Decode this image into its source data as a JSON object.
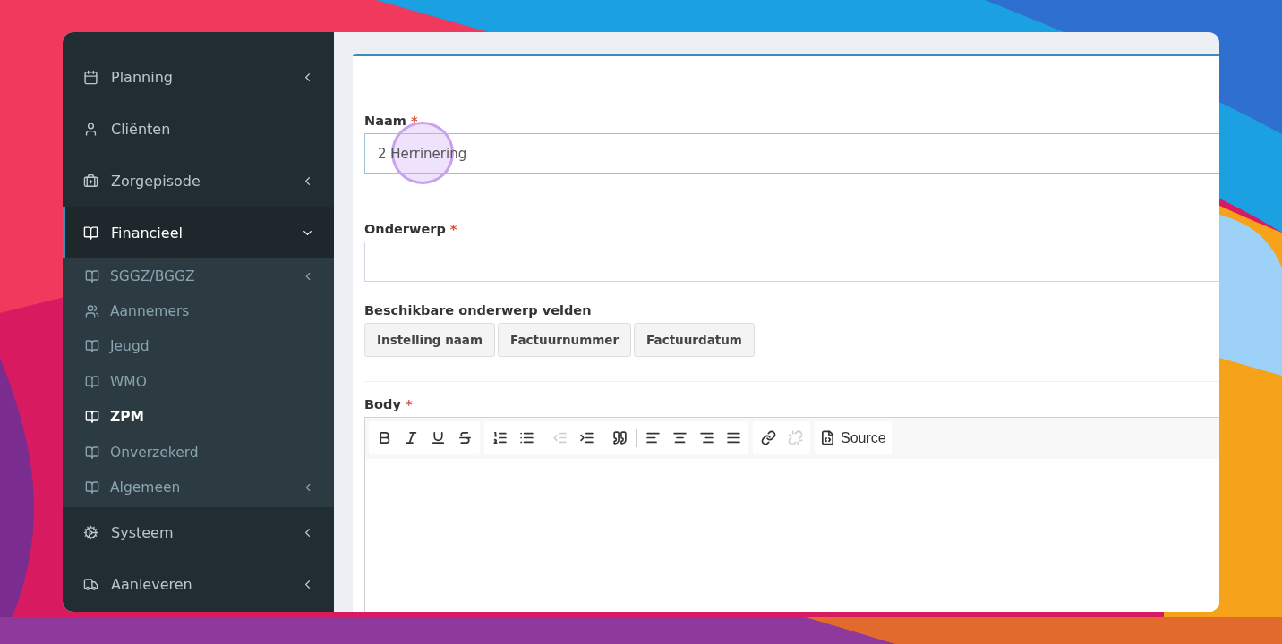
{
  "sidebar": {
    "items": [
      {
        "label": "Planning",
        "kind": "calendar",
        "selected": false,
        "expanded": false,
        "has_submenu": true
      },
      {
        "label": "Cliënten",
        "kind": "user",
        "selected": false,
        "has_submenu": false
      },
      {
        "label": "Zorgepisode",
        "kind": "medkit",
        "selected": false,
        "expanded": false,
        "has_submenu": true
      },
      {
        "label": "Financieel",
        "kind": "book",
        "selected": true,
        "expanded": true,
        "has_submenu": true,
        "children": [
          {
            "label": "SGGZ/BGGZ",
            "kind": "book",
            "selected": false,
            "has_submenu": true
          },
          {
            "label": "Aannemers",
            "kind": "users",
            "selected": false,
            "has_submenu": false
          },
          {
            "label": "Jeugd",
            "kind": "book",
            "selected": false,
            "has_submenu": false
          },
          {
            "label": "WMO",
            "kind": "book",
            "selected": false,
            "has_submenu": false
          },
          {
            "label": "ZPM",
            "kind": "book",
            "selected": true,
            "has_submenu": false
          },
          {
            "label": "Onverzekerd",
            "kind": "book",
            "selected": false,
            "has_submenu": false
          },
          {
            "label": "Algemeen",
            "kind": "book",
            "selected": false,
            "has_submenu": true
          }
        ]
      },
      {
        "label": "Systeem",
        "kind": "cogs",
        "selected": false,
        "expanded": false,
        "has_submenu": true
      },
      {
        "label": "Aanleveren",
        "kind": "truck",
        "selected": false,
        "expanded": false,
        "has_submenu": true
      }
    ]
  },
  "form": {
    "naam": {
      "label": "Naam",
      "required_mark": "*",
      "value": "2 Herrinering"
    },
    "onderwerp": {
      "label": "Onderwerp",
      "required_mark": "*"
    },
    "fields": {
      "label": "Beschikbare onderwerp velden",
      "buttons": [
        "Instelling naam",
        "Factuurnummer",
        "Factuurdatum"
      ]
    },
    "body": {
      "label": "Body",
      "required_mark": "*",
      "toolbar": [
        [
          {
            "kind": "bold",
            "disabled": false
          },
          {
            "kind": "italic",
            "disabled": false
          },
          {
            "kind": "underline",
            "disabled": false
          },
          {
            "kind": "strike",
            "disabled": false
          }
        ],
        [
          {
            "kind": "ordered-list",
            "disabled": false
          },
          {
            "kind": "bullet-list",
            "disabled": false
          },
          {
            "kind": "separator"
          },
          {
            "kind": "outdent",
            "disabled": true
          },
          {
            "kind": "indent",
            "disabled": false
          },
          {
            "kind": "separator"
          },
          {
            "kind": "quote",
            "disabled": false
          },
          {
            "kind": "separator"
          },
          {
            "kind": "align-left",
            "disabled": false
          },
          {
            "kind": "align-center",
            "disabled": false
          },
          {
            "kind": "align-right",
            "disabled": false
          },
          {
            "kind": "align-justify",
            "disabled": false
          }
        ],
        [
          {
            "kind": "link",
            "disabled": false
          },
          {
            "kind": "unlink",
            "disabled": true
          }
        ],
        [
          {
            "kind": "source",
            "label": "Source",
            "disabled": false
          }
        ]
      ]
    }
  }
}
